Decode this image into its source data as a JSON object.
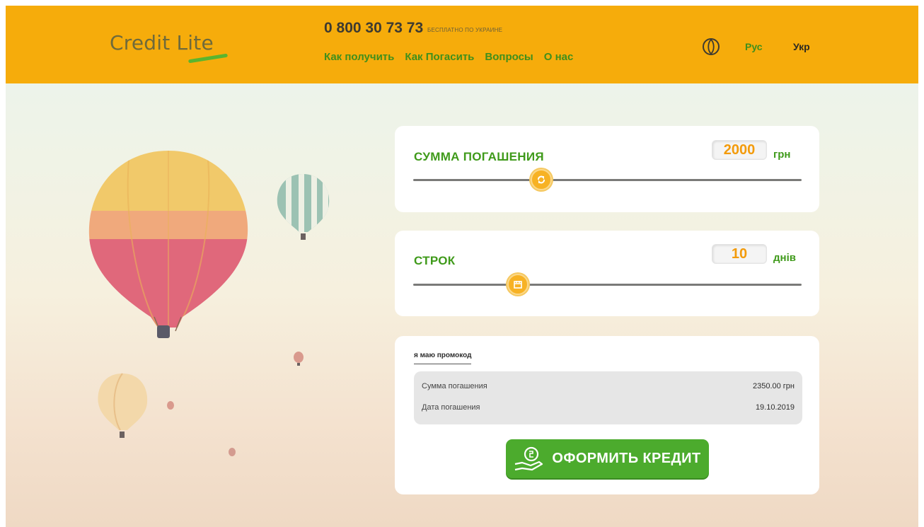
{
  "header": {
    "logo_text": "Credit Lite",
    "phone": "0 800 30 73 73",
    "phone_note": "БЕСПЛАТНО ПО УКРАИНЕ",
    "nav": [
      {
        "label": "Как получить"
      },
      {
        "label": "Как Погасить"
      },
      {
        "label": "Вопросы"
      },
      {
        "label": "О нас"
      }
    ],
    "languages": {
      "ru": "Рус",
      "uk": "Укр"
    },
    "colors": {
      "header_bg": "#f6ac0b",
      "accent_green": "#3f8f1c"
    }
  },
  "amount": {
    "title": "СУММА ПОГАШЕНИЯ",
    "value": "2000",
    "unit": "грн",
    "slider_level": 0.33
  },
  "term": {
    "title": "СТРОК",
    "value": "10",
    "unit": "днів",
    "slider_level": 0.27
  },
  "summary": {
    "promo_link": "я маю промокод",
    "rows": [
      {
        "label": "Сумма погашения",
        "value": "2350.00 грн"
      },
      {
        "label": "Дата погашения",
        "value": "19.10.2019"
      }
    ]
  },
  "cta": {
    "label": "ОФОРМИТЬ КРЕДИТ",
    "icon": "hand-coin-icon"
  }
}
